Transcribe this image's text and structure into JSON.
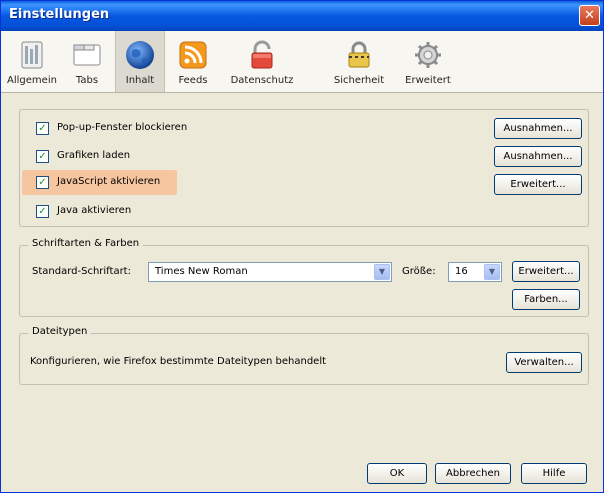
{
  "window": {
    "title": "Einstellungen",
    "close_glyph": "✕"
  },
  "toolbar": {
    "tabs": [
      {
        "label": "Allgemein",
        "icon": "general-icon"
      },
      {
        "label": "Tabs",
        "icon": "tabs-icon"
      },
      {
        "label": "Inhalt",
        "icon": "globe-icon",
        "selected": true
      },
      {
        "label": "Feeds",
        "icon": "rss-icon"
      },
      {
        "label": "Datenschutz",
        "icon": "privacy-icon"
      },
      {
        "label": "Sicherheit",
        "icon": "lock-icon"
      },
      {
        "label": "Erweitert",
        "icon": "gear-icon"
      }
    ]
  },
  "content": {
    "checkboxes": [
      {
        "label": "Pop-up-Fenster blockieren",
        "checked": true,
        "button": "Ausnahmen..."
      },
      {
        "label": "Grafiken laden",
        "checked": true,
        "button": "Ausnahmen..."
      },
      {
        "label": "JavaScript aktivieren",
        "checked": true,
        "button": "Erweitert...",
        "highlighted": true
      },
      {
        "label": "Java aktivieren",
        "checked": true
      }
    ],
    "check_glyph": "✓"
  },
  "fonts": {
    "group_title": "Schriftarten & Farben",
    "default_font_label": "Standard-Schriftart:",
    "default_font_value": "Times New Roman",
    "size_label": "Größe:",
    "size_value": "16",
    "advanced_button": "Erweitert...",
    "colors_button": "Farben...",
    "dropdown_glyph": "▼"
  },
  "filetypes": {
    "group_title": "Dateitypen",
    "description": "Konfigurieren, wie Firefox bestimmte Dateitypen behandelt",
    "manage_button": "Verwalten..."
  },
  "footer": {
    "ok": "OK",
    "cancel": "Abbrechen",
    "help": "Hilfe"
  },
  "colors": {
    "title_bar": "#0758e0",
    "highlight": "#f6c6a0",
    "dialog_bg": "#ece9d8"
  }
}
